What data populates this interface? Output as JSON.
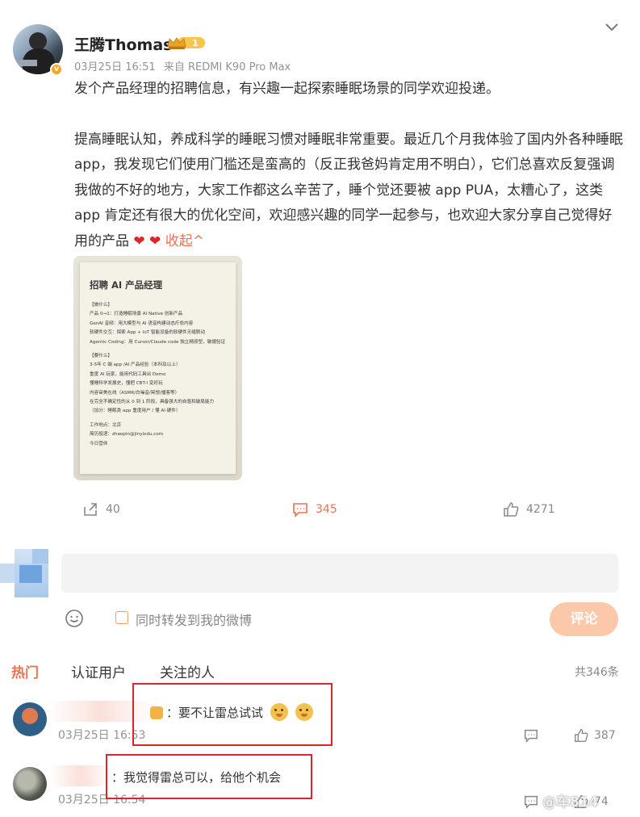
{
  "post": {
    "author": "王腾Thomas",
    "vip_level": "1",
    "date": "03月25日 16:51",
    "source": "来自 REDMI K90 Pro Max",
    "paragraph1": "发个产品经理的招聘信息，有兴趣一起探索睡眠场景的同学欢迎投递。",
    "paragraph2": "提高睡眠认知，养成科学的睡眠习惯对睡眠非常重要。最近几个月我体验了国内外各种睡眠 app，我发现它们使用门槛还是蛮高的（反正我爸妈肯定用不明白），它们总喜欢反复强调我做的不好的地方，大家工作都这么辛苦了，睡个觉还要被 app PUA，太糟心了，这类 app 肯定还有很大的优化空间，欢迎感兴趣的同学一起参与，也欢迎大家分享自己觉得好用的产品",
    "collapse_label": "收起^",
    "hearts": "❤ ❤"
  },
  "job_image": {
    "title": "招聘 AI 产品经理",
    "lines": [
      "【做什么】",
      "产品 0→1：打造睡眠场景 AI Native 创新产品",
      "GenAI 音频：用大模型与 AI 语音构建动态疗愈内容",
      "软硬件交互：探索 App + IoT 智能设备的软硬件无缝联动",
      "Agentic Coding：用 Cursor/Claude code 独立精原型，敏捷验证",
      "",
      "【要什么】",
      "3-5年 C 端 app /AI 产品经验（本科及以上）",
      "重度 AI 玩家，能用代码工具出 Demo",
      "懂睡科学发展史，懂把 CBT-I 变好玩",
      "内容审美在线（ASMR/白噪音/冥想/播客等）",
      "在完全不确定性的从 0 到 1 阶段，具备强大的自驱和破局能力",
      "（加分：睡眠类 app 重度用户 / 懂 AI 硬件）",
      "",
      "工作地点：北京",
      "简历投递：zhaopin@jinyixdu.com",
      "今日营休"
    ]
  },
  "actions": {
    "repost_count": "40",
    "comment_count": "345",
    "like_count": "4271"
  },
  "composer": {
    "placeholder": "",
    "repost_label": "同时转发到我的微博",
    "submit_label": "评论"
  },
  "tabs": {
    "hot": "热门",
    "verified": "认证用户",
    "following": "关注的人",
    "total": "共346条"
  },
  "comments": [
    {
      "text": "：要不让雷总试试",
      "time": "03月25日 16:53",
      "likes": "387"
    },
    {
      "text": "：我觉得雷总可以，给他个机会",
      "time": "03月25日 16:54",
      "likes": "74"
    }
  ],
  "watermark": "@车814",
  "colors": {
    "accent": "#eb7350",
    "annotation_red": "#d8262b"
  }
}
